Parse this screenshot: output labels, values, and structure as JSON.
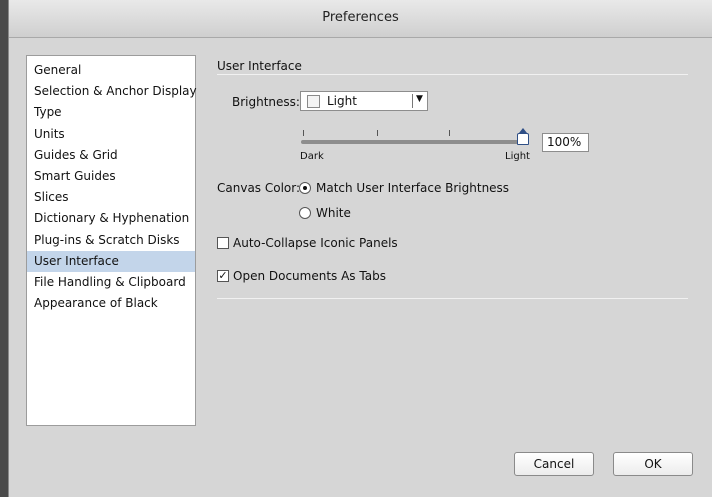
{
  "window": {
    "title": "Preferences"
  },
  "sidebar": {
    "items": [
      {
        "label": "General"
      },
      {
        "label": "Selection & Anchor Display"
      },
      {
        "label": "Type"
      },
      {
        "label": "Units"
      },
      {
        "label": "Guides & Grid"
      },
      {
        "label": "Smart Guides"
      },
      {
        "label": "Slices"
      },
      {
        "label": "Dictionary & Hyphenation"
      },
      {
        "label": "Plug-ins & Scratch Disks"
      },
      {
        "label": "User Interface"
      },
      {
        "label": "File Handling & Clipboard"
      },
      {
        "label": "Appearance of Black"
      }
    ],
    "selected": "User Interface"
  },
  "panel": {
    "section_title": "User Interface",
    "brightness": {
      "label": "Brightness:",
      "selected": "Light",
      "slider_min_label": "Dark",
      "slider_max_label": "Light",
      "value_text": "100%",
      "value_fraction": 1.0
    },
    "canvas_color": {
      "label": "Canvas Color:",
      "options": [
        "Match User Interface Brightness",
        "White"
      ],
      "selected": "Match User Interface Brightness"
    },
    "auto_collapse": {
      "label": "Auto-Collapse Iconic Panels",
      "checked": false
    },
    "open_as_tabs": {
      "label": "Open Documents As Tabs",
      "checked": true
    }
  },
  "buttons": {
    "cancel": "Cancel",
    "ok": "OK"
  }
}
